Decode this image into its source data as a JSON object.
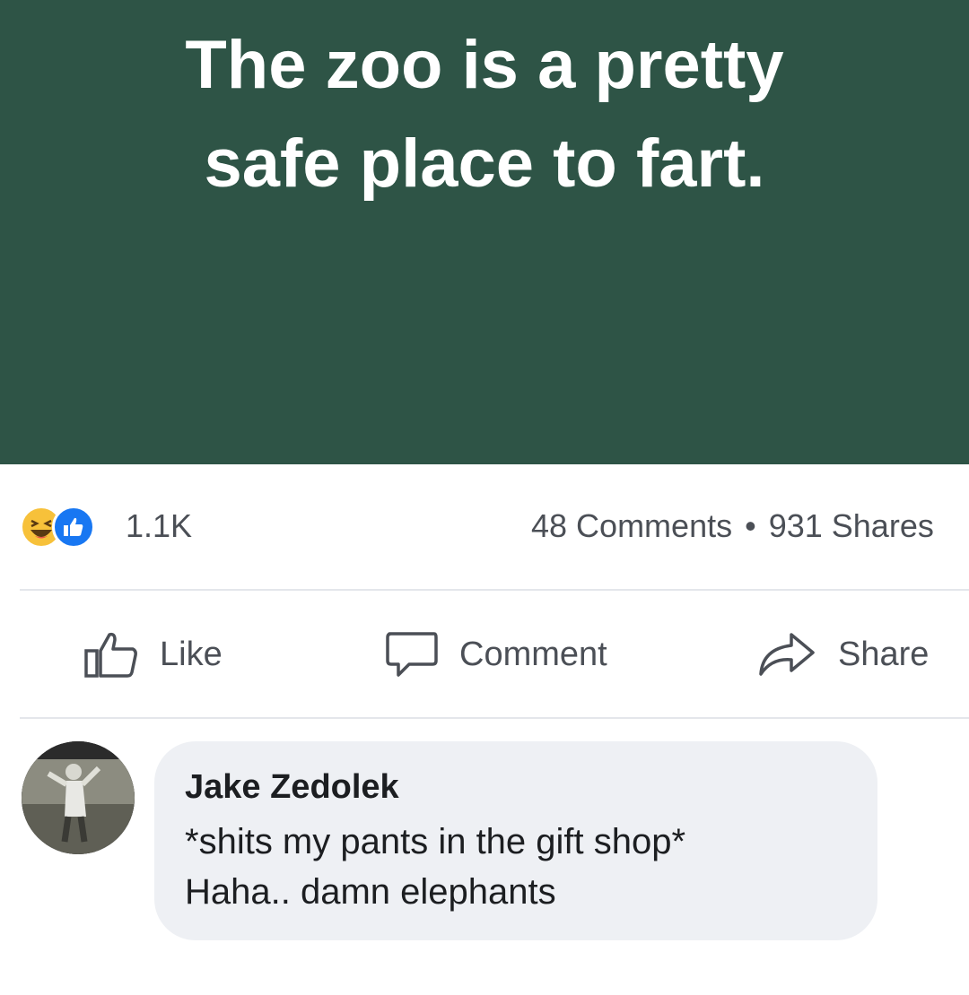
{
  "post": {
    "text": "The zoo is a pretty safe place to fart.",
    "background_color": "#2e5446"
  },
  "stats": {
    "reactions": [
      "haha",
      "like"
    ],
    "reaction_count": "1.1K",
    "comments": "48 Comments",
    "separator": "•",
    "shares": "931 Shares"
  },
  "actions": {
    "like_label": "Like",
    "comment_label": "Comment",
    "share_label": "Share"
  },
  "comment": {
    "author": "Jake Zedolek",
    "line1": "*shits my pants in the gift shop*",
    "line2": "Haha.. damn elephants"
  },
  "icons": {
    "like": "thumbs-up-icon",
    "comment": "speech-bubble-icon",
    "share": "share-arrow-icon"
  }
}
